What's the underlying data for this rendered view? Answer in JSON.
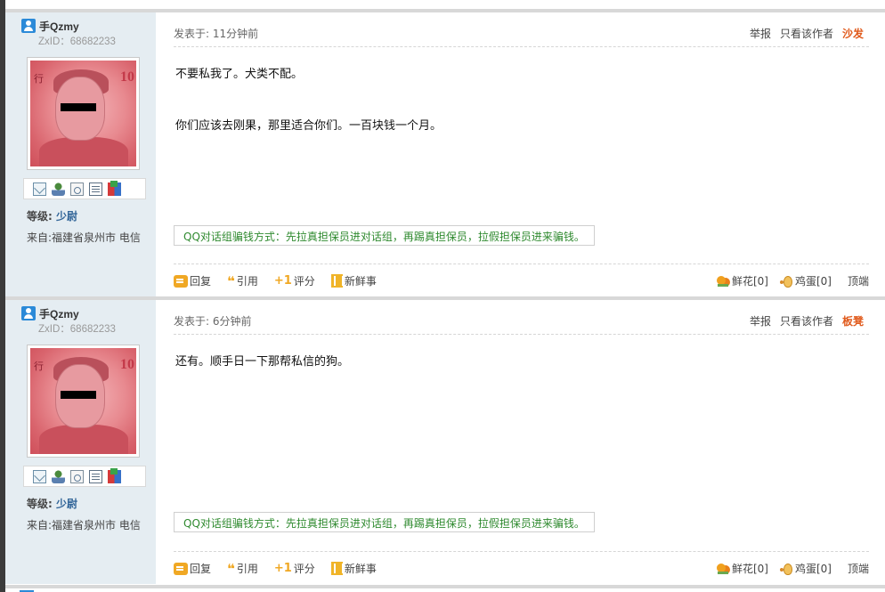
{
  "posts": [
    {
      "user": {
        "name": "手Qzmy",
        "zxid": "ZxID：68682233",
        "level_label": "等级:",
        "rank": "少尉",
        "from": "来自:福建省泉州市 电信"
      },
      "meta": {
        "time": "发表于: 11分钟前",
        "report": "举报",
        "only_author": "只看该作者",
        "floor": "沙发"
      },
      "content": [
        "不要私我了。犬类不配。",
        "你们应该去刚果，那里适合你们。一百块钱一个月。"
      ],
      "notice": "QQ对话组骗钱方式：先拉真担保员进对话组，再踢真担保员，拉假担保员进来骗钱。",
      "actions": {
        "reply": "回复",
        "quote": "引用",
        "rate": "评分",
        "news": "新鲜事",
        "flower": "鲜花[0]",
        "egg": "鸡蛋[0]",
        "top": "顶端"
      }
    },
    {
      "user": {
        "name": "手Qzmy",
        "zxid": "ZxID：68682233",
        "level_label": "等级:",
        "rank": "少尉",
        "from": "来自:福建省泉州市 电信"
      },
      "meta": {
        "time": "发表于: 6分钟前",
        "report": "举报",
        "only_author": "只看该作者",
        "floor": "板凳"
      },
      "content": [
        "还有。顺手日一下那帮私信的狗。"
      ],
      "notice": "QQ对话组骗钱方式：先拉真担保员进对话组，再踢真担保员，拉假担保员进来骗钱。",
      "actions": {
        "reply": "回复",
        "quote": "引用",
        "rate": "评分",
        "news": "新鲜事",
        "flower": "鲜花[0]",
        "egg": "鸡蛋[0]",
        "top": "顶端"
      }
    }
  ],
  "icons": {
    "avatar_symbols": {
      "chn": "行",
      "num": "10"
    },
    "user": "user-icon",
    "profile_icons": [
      "mail-icon",
      "add-friend-icon",
      "profile-doc-icon",
      "card-icon",
      "blocks-icon"
    ],
    "actions": [
      "reply-icon",
      "quote-icon",
      "rate-icon",
      "news-icon",
      "flower-icon",
      "egg-icon"
    ]
  },
  "colors": {
    "accent": "#e05a1c",
    "rank": "#336699",
    "notice": "#2f8a2f",
    "sidebar_bg": "#e5edf2"
  }
}
